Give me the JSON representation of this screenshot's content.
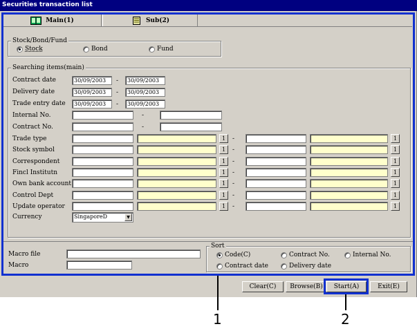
{
  "window": {
    "title": "Securities transaction list"
  },
  "tabs": [
    {
      "label": "Main(1)",
      "icon": "book-icon"
    },
    {
      "label": "Sub(2)",
      "icon": "notepad-icon"
    }
  ],
  "type_group": {
    "title": "Stock/Bond/Fund",
    "options": [
      "Stock",
      "Bond",
      "Fund"
    ],
    "selected": "Stock"
  },
  "search": {
    "title": "Searching items(main)",
    "dash": "-",
    "button_label": "1",
    "date_rows": [
      {
        "label": "Contract date",
        "from": "30/09/2003",
        "to": "30/09/2003"
      },
      {
        "label": "Delivery date",
        "from": "30/09/2003",
        "to": "30/09/2003"
      },
      {
        "label": "Trade entry date",
        "from": "30/09/2003",
        "to": "30/09/2003"
      }
    ],
    "range_rows": [
      {
        "label": "Internal No."
      },
      {
        "label": "Contract No."
      }
    ],
    "code_rows": [
      {
        "label": "Trade type"
      },
      {
        "label": "Stock symbol"
      },
      {
        "label": "Correspondent"
      },
      {
        "label": "Fincl Institutn"
      },
      {
        "label": "Own bank account"
      },
      {
        "label": "Control Dept"
      },
      {
        "label": "Update operator"
      }
    ],
    "currency": {
      "label": "Currency",
      "value": "SingaporeD"
    }
  },
  "macro": {
    "file_label": "Macro file",
    "macro_label": "Macro",
    "file_value": "",
    "macro_value": ""
  },
  "sort": {
    "title": "Sort",
    "options": [
      "Code(C)",
      "Contract No.",
      "Internal No.",
      "Contract date",
      "Delivery date"
    ],
    "selected": "Code(C)"
  },
  "buttons": {
    "clear": "Clear(C)",
    "browse": "Browse(B)",
    "start": "Start(A)",
    "exit": "Exit(E)"
  },
  "callouts": [
    "1",
    "2"
  ],
  "colors": {
    "highlight": "#1030d0",
    "titlebar": "#000080",
    "yellow_field": "#ffffcc",
    "window": "#d4d0c8"
  }
}
